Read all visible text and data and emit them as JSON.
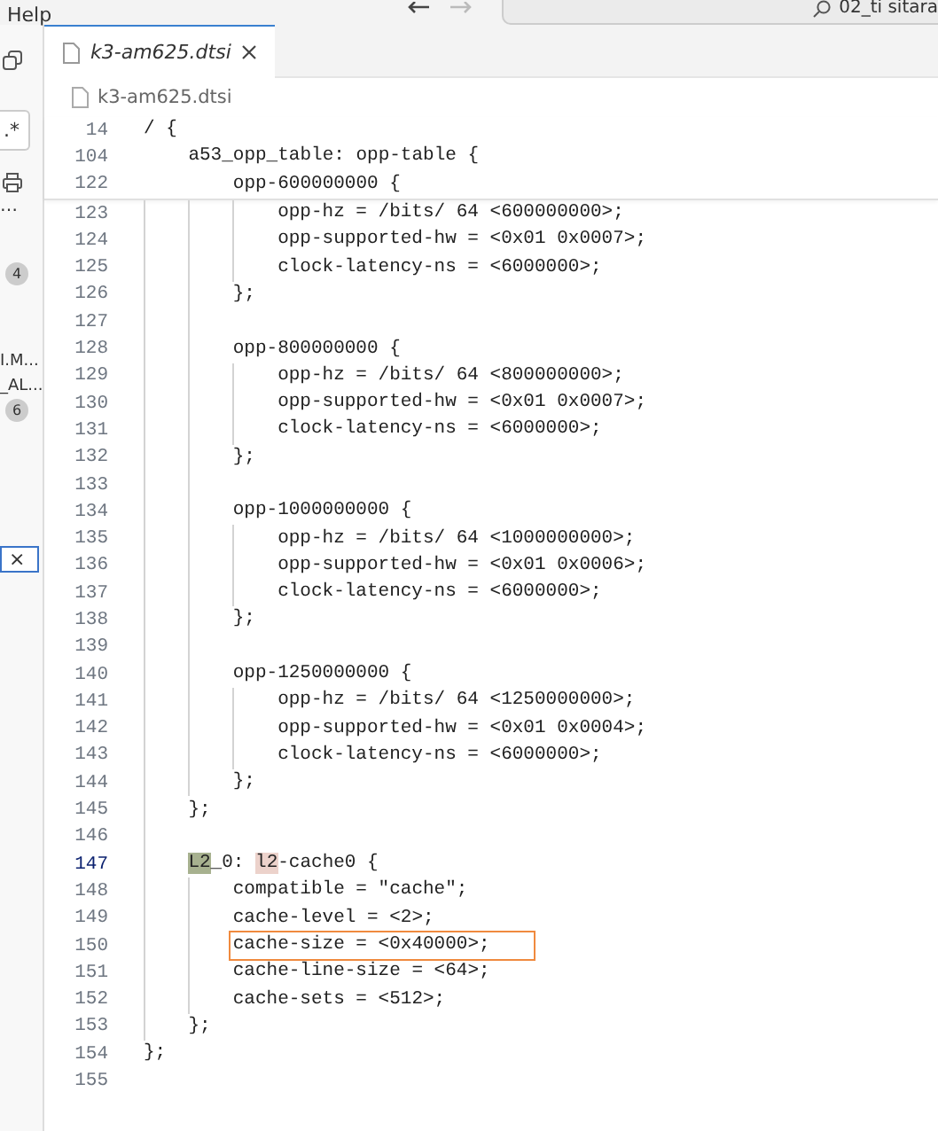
{
  "menu": {
    "label": "Help"
  },
  "search": {
    "value": "02_ti sitara"
  },
  "sidebar": {
    "items": [
      {
        "kind": "toggle",
        "label": ".*"
      },
      {
        "kind": "more",
        "label": "…"
      },
      {
        "kind": "badge",
        "label": "4"
      },
      {
        "kind": "text",
        "label": "I.M..."
      },
      {
        "kind": "text",
        "label": "_AL..."
      },
      {
        "kind": "badge",
        "label": "6"
      },
      {
        "kind": "close",
        "label": "×"
      }
    ]
  },
  "tabs": [
    {
      "label": "k3-am625.dtsi",
      "selected": true
    }
  ],
  "breadcrumb": [
    "k3-am625.dtsi"
  ],
  "sticky_lines": [
    {
      "number": "14",
      "text": "/ {"
    },
    {
      "number": "104",
      "text": "    a53_opp_table: opp-table {"
    },
    {
      "number": "122",
      "text": "        opp-600000000 {"
    }
  ],
  "lines": [
    {
      "number": "123",
      "text": "            opp-hz = /bits/ 64 <600000000>;",
      "current": false,
      "boxed": false
    },
    {
      "number": "124",
      "text": "            opp-supported-hw = <0x01 0x0007>;",
      "current": false,
      "boxed": false
    },
    {
      "number": "125",
      "text": "            clock-latency-ns = <6000000>;",
      "current": false,
      "boxed": false
    },
    {
      "number": "126",
      "text": "        };",
      "current": false,
      "boxed": false
    },
    {
      "number": "127",
      "current": false
    },
    {
      "number": "128",
      "text": "        opp-800000000 {",
      "current": false,
      "boxed": false
    },
    {
      "number": "129",
      "text": "            opp-hz = /bits/ 64 <800000000>;",
      "current": false,
      "boxed": false
    },
    {
      "number": "130",
      "text": "            opp-supported-hw = <0x01 0x0007>;",
      "current": false,
      "boxed": false
    },
    {
      "number": "131",
      "text": "            clock-latency-ns = <6000000>;",
      "current": false,
      "boxed": false
    },
    {
      "number": "132",
      "text": "        };",
      "current": false,
      "boxed": false
    },
    {
      "number": "133",
      "current": false
    },
    {
      "number": "134",
      "text": "        opp-1000000000 {",
      "current": false,
      "boxed": false
    },
    {
      "number": "135",
      "text": "            opp-hz = /bits/ 64 <1000000000>;",
      "current": false,
      "boxed": false
    },
    {
      "number": "136",
      "text": "            opp-supported-hw = <0x01 0x0006>;",
      "current": false,
      "boxed": false
    },
    {
      "number": "137",
      "text": "            clock-latency-ns = <6000000>;",
      "current": false,
      "boxed": false
    },
    {
      "number": "138",
      "text": "        };",
      "current": false,
      "boxed": false
    },
    {
      "number": "139",
      "current": false
    },
    {
      "number": "140",
      "text": "        opp-1250000000 {",
      "current": false,
      "boxed": false
    },
    {
      "number": "141",
      "text": "            opp-hz = /bits/ 64 <1250000000>;",
      "current": false,
      "boxed": false
    },
    {
      "number": "142",
      "text": "            opp-supported-hw = <0x01 0x0004>;",
      "current": false,
      "boxed": false
    },
    {
      "number": "143",
      "text": "            clock-latency-ns = <6000000>;",
      "current": false,
      "boxed": false
    },
    {
      "number": "144",
      "text": "        };",
      "current": false,
      "boxed": false
    },
    {
      "number": "145",
      "text": "    };",
      "current": false,
      "boxed": false
    },
    {
      "number": "146",
      "current": false
    },
    {
      "number": "147",
      "parts": [
        {
          "text": "    L2",
          "kind": "write-highlight"
        },
        {
          "text": "_0: ",
          "kind": "plain"
        },
        {
          "text": "l2",
          "kind": "read-highlight"
        },
        {
          "text": "-cache0 {",
          "kind": "plain"
        }
      ],
      "current": true,
      "boxed": false
    },
    {
      "number": "148",
      "text": "        compatible = \"cache\";",
      "current": false,
      "boxed": false
    },
    {
      "number": "149",
      "text": "        cache-level = <2>;",
      "current": false,
      "boxed": false
    },
    {
      "number": "150",
      "text": "        cache-size = <0x40000>;",
      "current": false,
      "boxed": true
    },
    {
      "number": "151",
      "text": "        cache-line-size = <64>;",
      "current": false,
      "boxed": false
    },
    {
      "number": "152",
      "text": "        cache-sets = <512>;",
      "current": false,
      "boxed": false
    },
    {
      "number": "153",
      "text": "    };",
      "current": false,
      "boxed": false
    },
    {
      "number": "154",
      "text": "};",
      "current": false,
      "boxed": false
    },
    {
      "number": "155",
      "current": false
    }
  ]
}
